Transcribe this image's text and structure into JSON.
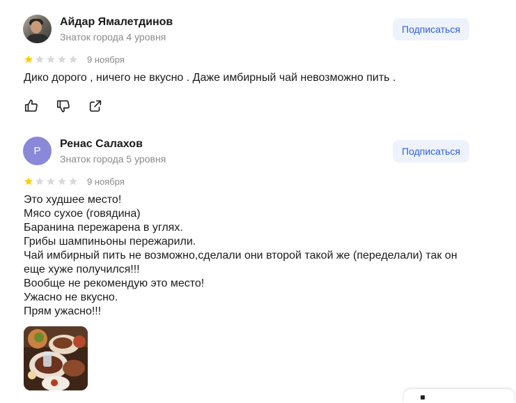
{
  "reviews": [
    {
      "author": "Айдар Ямалетдинов",
      "level": "Знаток города 4 уровня",
      "subscribe_label": "Подписаться",
      "rating": 1,
      "max_rating": 5,
      "date": "9 ноября",
      "text": "Дико дорого , ничего не вкусно . Даже имбирный чай невозможно пить .",
      "avatar_icon": "user-photo"
    },
    {
      "author": "Ренас Салахов",
      "level": "Знаток города 5 уровня",
      "subscribe_label": "Подписаться",
      "rating": 1,
      "max_rating": 5,
      "date": "9 ноября",
      "avatar_letter": "Р",
      "text_lines": [
        "Это худшее место!",
        "Мясо сухое (говядина)",
        "Баранина пережарена в углях.",
        "Грибы шампиньоны пережарили.",
        "Чай имбирный пить не возможно,сделали они второй такой же (переделали) так он",
        "еще хуже получился!!!",
        "Вообще не рекомендую это место!",
        "Ужасно не вкусно.",
        "Прям ужасно!!!"
      ]
    }
  ],
  "colors": {
    "star_filled": "#fc0",
    "star_empty": "#d8d8d8",
    "subscribe_bg": "#eef2fb",
    "subscribe_text": "#2f5fe0",
    "avatar_letter_bg": "#8a88d8"
  },
  "icons": [
    "like-icon",
    "dislike-icon",
    "share-icon"
  ]
}
